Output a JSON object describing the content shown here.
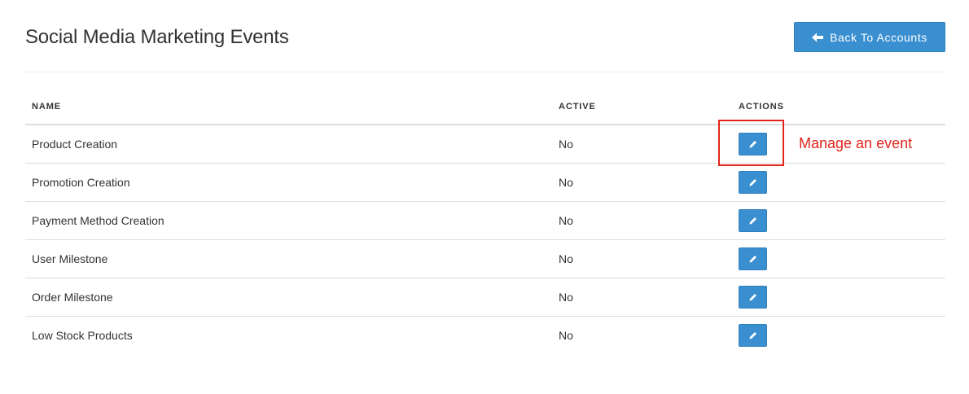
{
  "page": {
    "title": "Social Media Marketing Events",
    "back_button_label": "Back To Accounts",
    "back_icon": "arrow-left-icon"
  },
  "table": {
    "columns": [
      "NAME",
      "ACTIVE",
      "ACTIONS"
    ],
    "edit_icon": "pencil-icon",
    "rows": [
      {
        "name": "Product Creation",
        "active": "No"
      },
      {
        "name": "Promotion Creation",
        "active": "No"
      },
      {
        "name": "Payment Method Creation",
        "active": "No"
      },
      {
        "name": "User Milestone",
        "active": "No"
      },
      {
        "name": "Order Milestone",
        "active": "No"
      },
      {
        "name": "Low Stock Products",
        "active": "No"
      }
    ]
  },
  "annotation": {
    "label": "Manage an event",
    "color": "#e0241b"
  },
  "colors": {
    "primary_button": "#3a8fd0",
    "rule": "#dddddd"
  }
}
